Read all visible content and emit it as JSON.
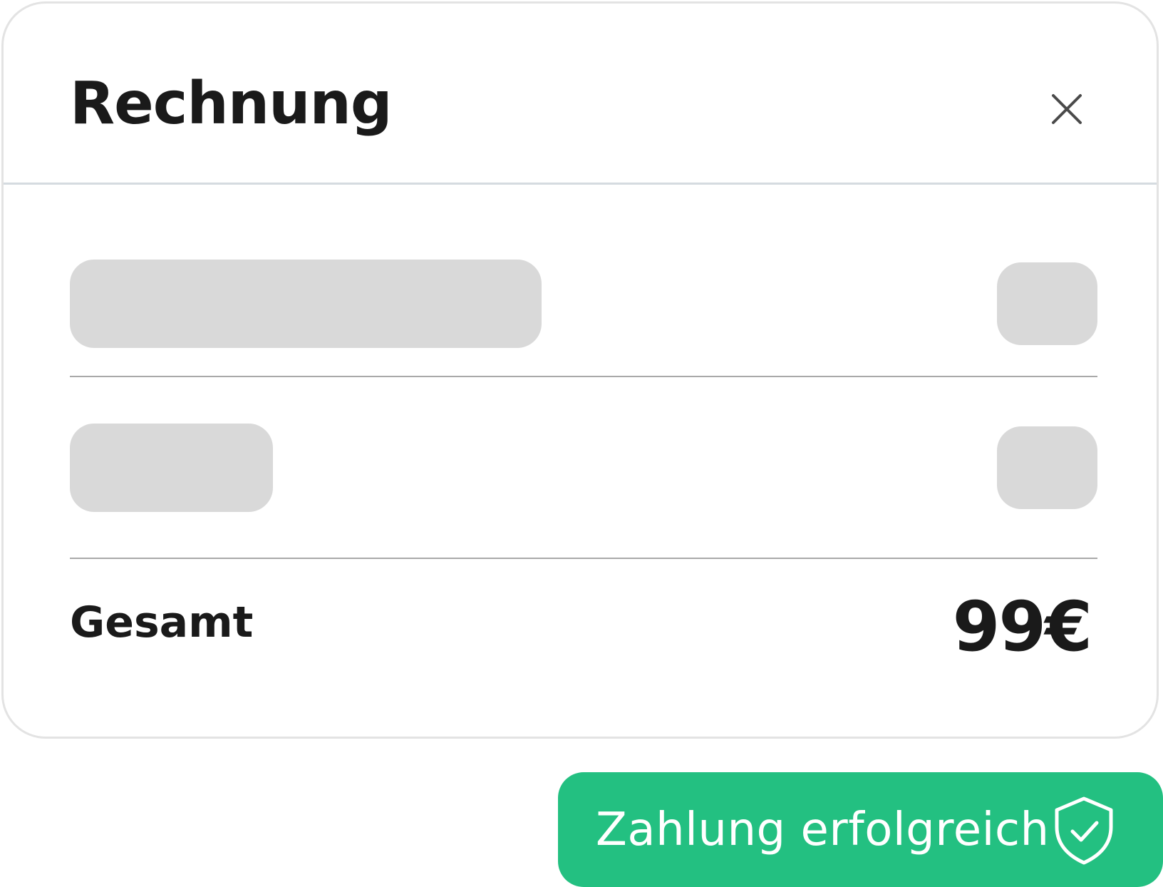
{
  "invoice": {
    "title": "Rechnung",
    "total_label": "Gesamt",
    "total_value": "99€"
  },
  "icons": {
    "close": "close-icon",
    "shield_check": "shield-check-icon"
  },
  "notification": {
    "message": "Zahlung erfolgreich"
  },
  "colors": {
    "success": "#23c081",
    "skeleton": "#d9d9d9",
    "text": "#1a1a1a",
    "border": "#e3e3e3"
  }
}
